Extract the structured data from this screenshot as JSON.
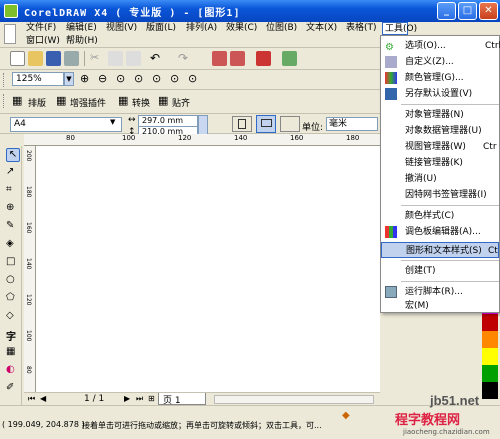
{
  "window": {
    "title": "CorelDRAW X4 ( 专业版 ) - [图形1]"
  },
  "menubar": {
    "row1": [
      "文件(F)",
      "编辑(E)",
      "视图(V)",
      "版面(L)",
      "排列(A)",
      "效果(C)",
      "位图(B)",
      "文本(X)",
      "表格(T)",
      "工具(O)"
    ],
    "row2": [
      "窗口(W)",
      "帮助(H)"
    ]
  },
  "zoom": {
    "value": "125%"
  },
  "toolbar3": {
    "items": [
      "排版",
      "增强插件",
      "转换",
      "贴齐"
    ]
  },
  "property_bar": {
    "paper": "A4",
    "width": "297.0 mm",
    "height": "210.0 mm",
    "units_label": "单位:",
    "units": "毫米"
  },
  "ruler": {
    "marks": [
      "80",
      "100",
      "120",
      "140",
      "160",
      "180"
    ],
    "vmarks": [
      "200",
      "180",
      "160",
      "140",
      "120",
      "100",
      "80"
    ]
  },
  "pagebar": {
    "page_info": "1 / 1",
    "page_tab": "页 1"
  },
  "status": {
    "coords": "( 199.049, 204.878 )",
    "hint": "接着单击可进行拖动或缩放；再单击可旋转或倾斜；双击工具，可..."
  },
  "tools_menu": {
    "items": [
      {
        "label": "选项(O)...",
        "shortcut": "Ctrl",
        "icon": "options-icon"
      },
      {
        "label": "自定义(Z)...",
        "shortcut": "",
        "icon": "customize-icon"
      },
      {
        "label": "颜色管理(G)...",
        "shortcut": "",
        "icon": "color-management-icon"
      },
      {
        "label": "另存默认设置(V)",
        "shortcut": "",
        "icon": "save-defaults-icon"
      },
      {
        "label": "对象管理器(N)",
        "shortcut": "",
        "icon": ""
      },
      {
        "label": "对象数据管理器(U)",
        "shortcut": "",
        "icon": ""
      },
      {
        "label": "视图管理器(W)",
        "shortcut": "Ctr",
        "icon": ""
      },
      {
        "label": "链接管理器(K)",
        "shortcut": "",
        "icon": ""
      },
      {
        "label": "撤消(U)",
        "shortcut": "",
        "icon": ""
      },
      {
        "label": "因特网书签管理器(I)",
        "shortcut": "",
        "icon": ""
      },
      {
        "label": "颜色样式(C)",
        "shortcut": "",
        "icon": ""
      },
      {
        "label": "调色板编辑器(A)...",
        "shortcut": "",
        "icon": "palette-editor-icon"
      },
      {
        "label": "图形和文本样式(S)",
        "shortcut": "Ct",
        "icon": ""
      },
      {
        "label": "创建(T)",
        "shortcut": "",
        "icon": ""
      },
      {
        "label": "运行脚本(R)...",
        "shortcut": "",
        "icon": "run-script-icon"
      },
      {
        "label": "宏(M)",
        "shortcut": "",
        "icon": ""
      }
    ]
  },
  "watermark": {
    "line1": "jb51.net",
    "line2": "程字教程网",
    "line3": "jiaocheng.chazidian.com"
  },
  "colors": {
    "title_blue": "#0a55d8",
    "menu_highlight": "#c1d2ee",
    "highlight_border": "#316ac5",
    "palette": [
      "#1a1aa0",
      "#ff00ff",
      "#c00000",
      "#ff8800",
      "#ffff00",
      "#00a000",
      "#000000"
    ]
  }
}
